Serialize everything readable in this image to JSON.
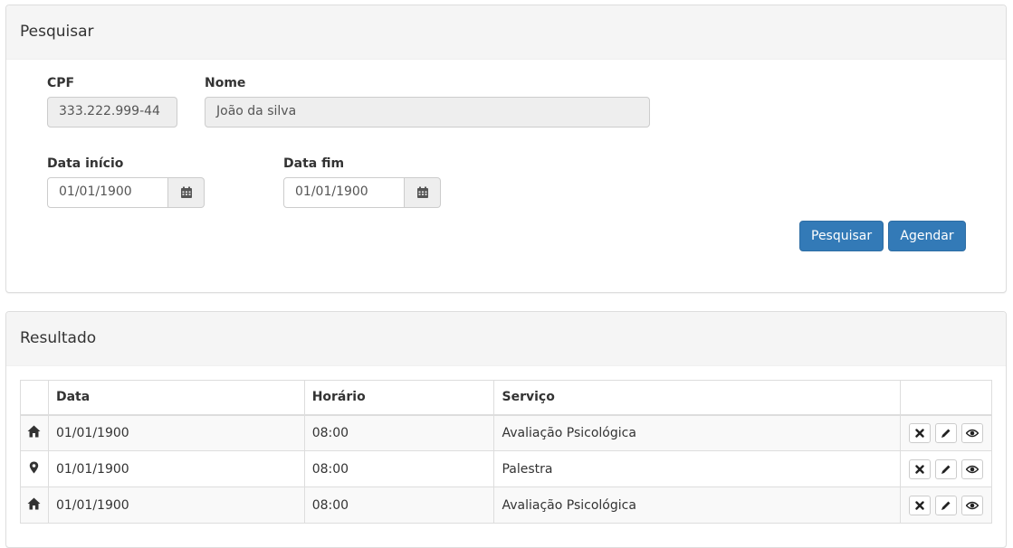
{
  "search_panel": {
    "title": "Pesquisar",
    "cpf": {
      "label": "CPF",
      "value": "333.222.999-44"
    },
    "nome": {
      "label": "Nome",
      "value": "João da silva"
    },
    "data_inicio": {
      "label": "Data início",
      "value": "01/01/1900"
    },
    "data_fim": {
      "label": "Data fim",
      "value": "01/01/1900"
    },
    "buttons": {
      "search": "Pesquisar",
      "schedule": "Agendar"
    }
  },
  "result_panel": {
    "title": "Resultado",
    "columns": [
      "",
      "Data",
      "Horário",
      "Serviço",
      ""
    ],
    "rows": [
      {
        "icon": "home-icon",
        "data": "01/01/1900",
        "horario": "08:00",
        "servico": "Avaliação Psicológica"
      },
      {
        "icon": "map-marker-icon",
        "data": "01/01/1900",
        "horario": "08:00",
        "servico": "Palestra"
      },
      {
        "icon": "home-icon",
        "data": "01/01/1900",
        "horario": "08:00",
        "servico": "Avaliação Psicológica"
      }
    ],
    "row_actions": [
      "remove-icon",
      "pencil-icon",
      "eye-icon"
    ]
  },
  "colors": {
    "primary": "#337ab7",
    "panel_heading": "#f5f5f5",
    "border": "#dddddd"
  }
}
